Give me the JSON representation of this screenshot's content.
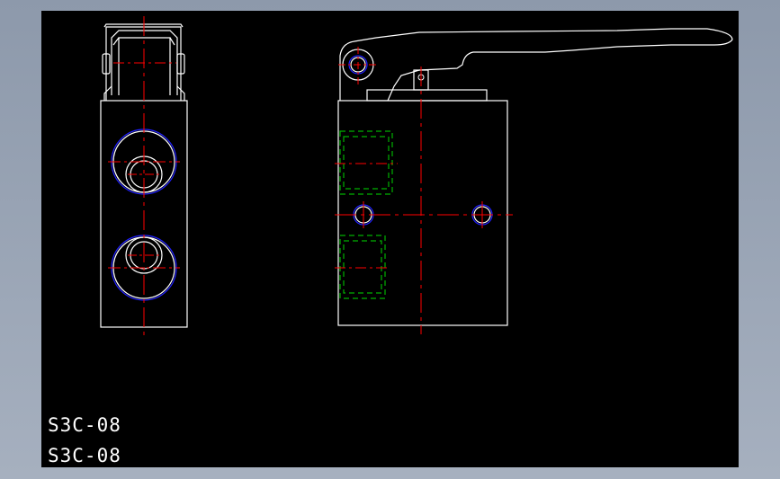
{
  "drawing": {
    "labels": [
      "S3C-08",
      "S3C-08"
    ],
    "colors": {
      "background": "#000000",
      "outline": "#ffffff",
      "centerline": "#ff0000",
      "hidden": "#00b000",
      "thread": "#2020ff",
      "frame": "#9aa4b4"
    }
  }
}
